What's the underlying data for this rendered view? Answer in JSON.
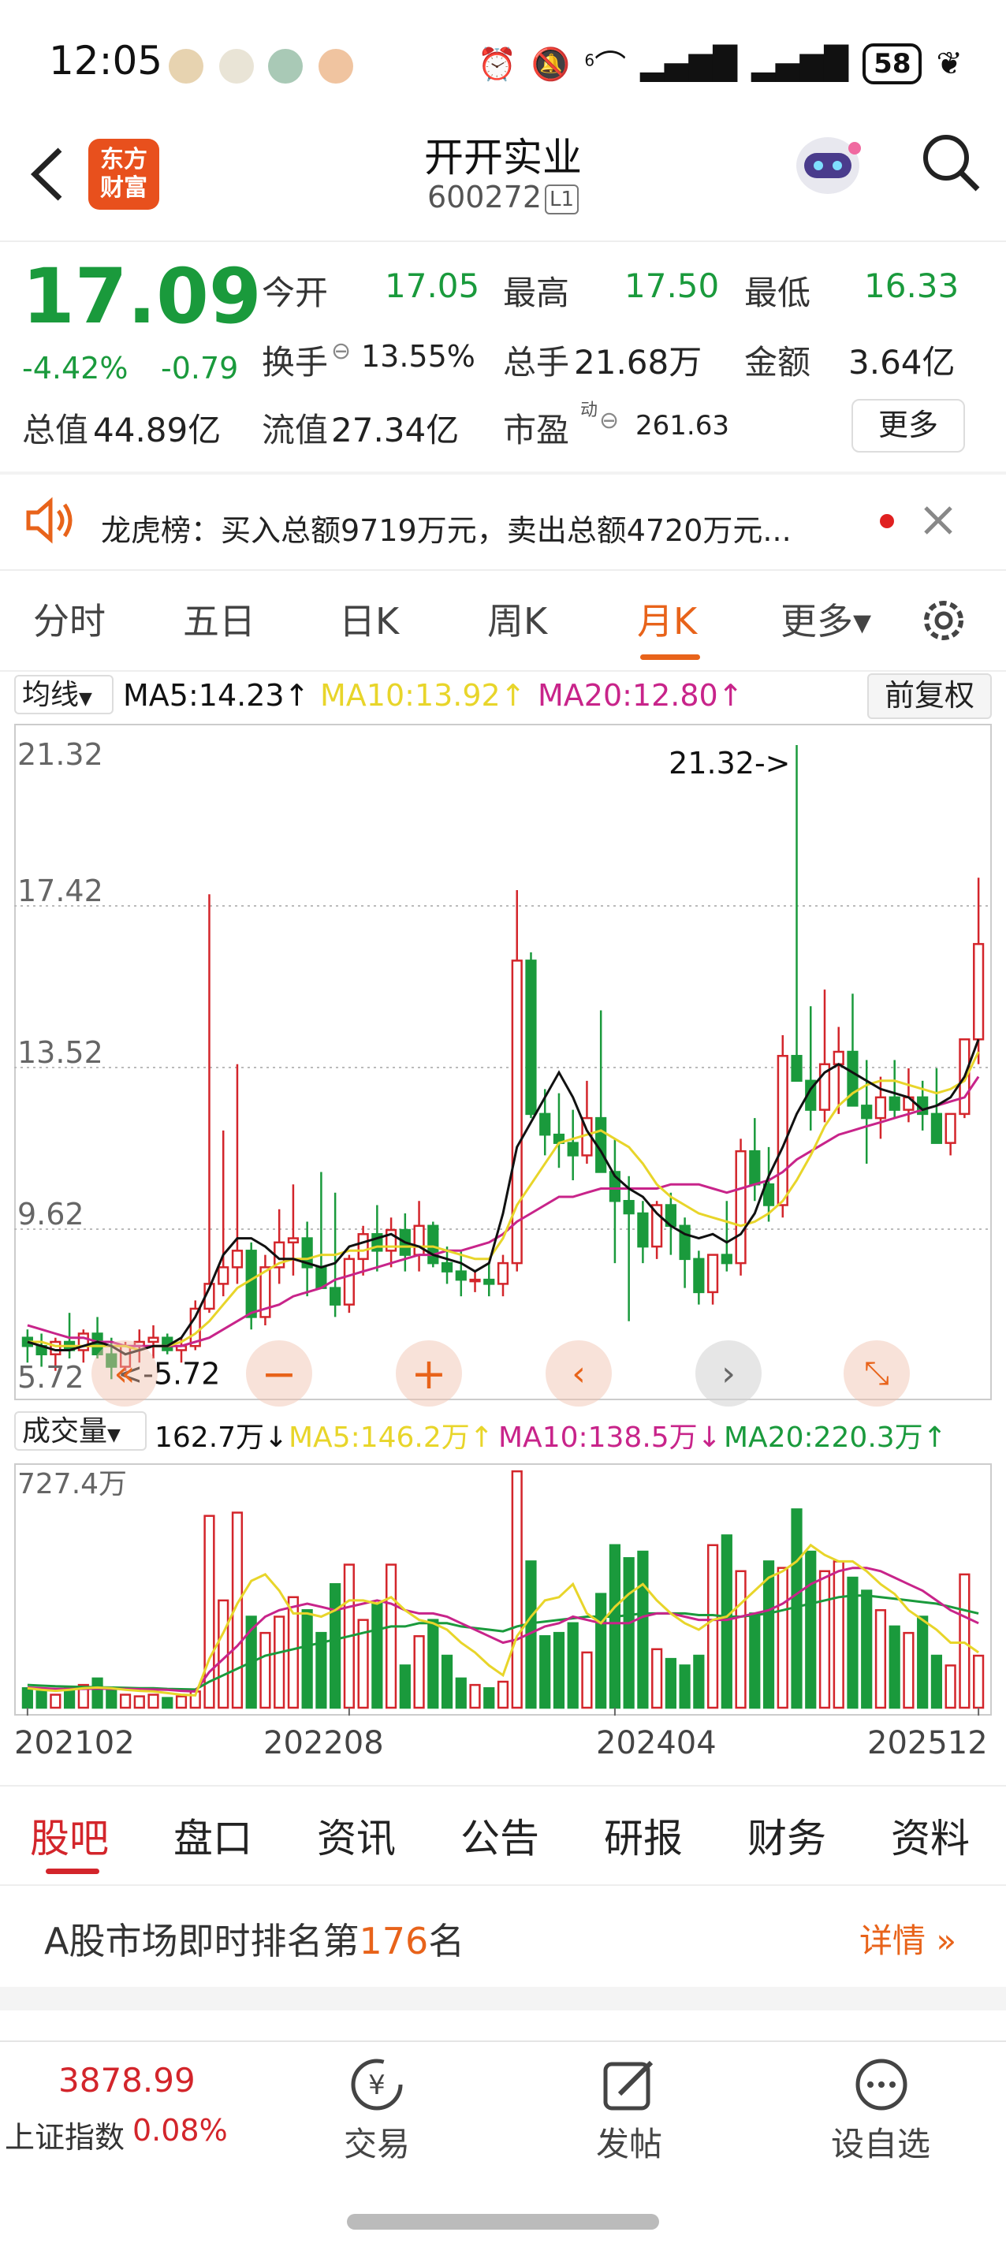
{
  "status_bar": {
    "time": "12:05",
    "signal_tag": "6",
    "battery": "58",
    "icons": [
      "alarm-icon",
      "mute-icon",
      "wifi-icon",
      "signal-icon",
      "signal-icon",
      "battery-icon",
      "leaf-icon"
    ]
  },
  "header": {
    "logo_line1": "东方",
    "logo_line2": "财富",
    "stock_name": "开开实业",
    "stock_code": "600272",
    "market_tag": "L1"
  },
  "quote": {
    "price": "17.09",
    "change_pct": "-4.42%",
    "change": "-0.79",
    "open_label": "今开",
    "open": "17.05",
    "high_label": "最高",
    "high": "17.50",
    "low_label": "最低",
    "low": "16.33",
    "turnover_label": "换手",
    "turnover": "13.55%",
    "volume_label": "总手",
    "volume": "21.68万",
    "amount_label": "金额",
    "amount": "3.64亿",
    "mktcap_label": "总值",
    "mktcap": "44.89亿",
    "float_label": "流值",
    "float_cap": "27.34亿",
    "pe_label": "市盈",
    "pe_sup": "动",
    "pe": "261.63",
    "more_label": "更多"
  },
  "notice": {
    "text": "龙虎榜：买入总额9719万元，卖出总额4720万元..."
  },
  "chart_tabs": [
    {
      "label": "分时"
    },
    {
      "label": "五日"
    },
    {
      "label": "日K"
    },
    {
      "label": "周K"
    },
    {
      "label": "月K"
    },
    {
      "label": "更多▾"
    }
  ],
  "ma_legend": {
    "selector": "均线",
    "ma5": "MA5:14.23↑",
    "ma10": "MA10:13.92↑",
    "ma20": "MA20:12.80↑",
    "adjust": "前复权"
  },
  "vol_legend": {
    "selector": "成交量",
    "vol": "162.7万↓",
    "ma5": "MA5:146.2万↑",
    "ma10": "MA10:138.5万↓",
    "ma20": "MA20:220.3万↑"
  },
  "colors": {
    "up": "#d3252b",
    "down": "#1a9a3c",
    "ma5": "#111111",
    "ma10": "#e8d52a",
    "ma20": "#c8248a",
    "accent": "#e8631a"
  },
  "chart_data": {
    "type": "candlestick",
    "price_axis_labels": [
      "21.32",
      "17.42",
      "13.52",
      "9.62",
      "5.72"
    ],
    "max_annotation": "21.32->",
    "min_annotation": "<-5.72",
    "ylim": [
      5.72,
      21.32
    ],
    "x_tick_labels": [
      "202102",
      "202208",
      "202404",
      "202512"
    ],
    "vol_axis_label": "727.4万",
    "vol_max": 727.4,
    "candles": [
      [
        7.0,
        7.2,
        6.4,
        6.8
      ],
      [
        6.8,
        7.1,
        6.3,
        6.6
      ],
      [
        6.6,
        7.0,
        6.2,
        6.9
      ],
      [
        6.9,
        7.6,
        6.5,
        6.7
      ],
      [
        6.7,
        7.2,
        6.4,
        7.1
      ],
      [
        7.1,
        7.5,
        6.5,
        6.6
      ],
      [
        6.6,
        7.0,
        6.0,
        6.3
      ],
      [
        6.3,
        6.9,
        6.2,
        6.8
      ],
      [
        6.8,
        7.2,
        6.4,
        6.9
      ],
      [
        6.9,
        7.3,
        6.5,
        7.0
      ],
      [
        7.0,
        7.1,
        6.6,
        6.7
      ],
      [
        6.7,
        7.0,
        6.4,
        6.8
      ],
      [
        6.8,
        7.9,
        6.7,
        7.7
      ],
      [
        7.7,
        17.7,
        7.6,
        8.3
      ],
      [
        8.3,
        12.0,
        8.0,
        8.7
      ],
      [
        8.7,
        13.6,
        8.3,
        9.1
      ],
      [
        9.1,
        9.3,
        7.2,
        7.5
      ],
      [
        7.5,
        9.0,
        7.3,
        8.7
      ],
      [
        8.7,
        10.1,
        8.3,
        9.3
      ],
      [
        9.3,
        10.7,
        8.5,
        9.4
      ],
      [
        9.4,
        9.8,
        8.0,
        8.7
      ],
      [
        8.7,
        11.0,
        8.3,
        8.2
      ],
      [
        8.2,
        10.5,
        7.5,
        7.8
      ],
      [
        7.8,
        9.0,
        7.6,
        8.9
      ],
      [
        8.9,
        9.7,
        8.5,
        9.5
      ],
      [
        9.5,
        10.2,
        8.6,
        9.1
      ],
      [
        9.1,
        9.9,
        8.7,
        9.6
      ],
      [
        9.6,
        10.0,
        8.6,
        9.0
      ],
      [
        9.0,
        10.3,
        8.6,
        9.7
      ],
      [
        9.7,
        9.8,
        8.7,
        8.8
      ],
      [
        8.8,
        9.2,
        8.3,
        8.6
      ],
      [
        8.6,
        9.1,
        8.0,
        8.4
      ],
      [
        8.4,
        8.6,
        8.1,
        8.4
      ],
      [
        8.4,
        8.8,
        8.0,
        8.3
      ],
      [
        8.3,
        9.0,
        8.0,
        8.8
      ],
      [
        8.8,
        17.8,
        8.6,
        16.1
      ],
      [
        16.1,
        16.3,
        12.3,
        12.4
      ],
      [
        12.4,
        13.0,
        11.4,
        11.9
      ],
      [
        11.9,
        12.9,
        11.1,
        11.7
      ],
      [
        11.7,
        12.5,
        10.8,
        11.4
      ],
      [
        11.4,
        13.2,
        11.2,
        12.3
      ],
      [
        12.3,
        14.9,
        12.0,
        11.0
      ],
      [
        11.0,
        11.8,
        8.8,
        10.3
      ],
      [
        10.3,
        10.9,
        7.4,
        10.0
      ],
      [
        10.0,
        10.3,
        8.8,
        9.2
      ],
      [
        9.2,
        10.3,
        8.9,
        10.2
      ],
      [
        10.2,
        10.5,
        9.0,
        9.7
      ],
      [
        9.7,
        9.9,
        8.2,
        8.9
      ],
      [
        8.9,
        9.1,
        7.8,
        8.1
      ],
      [
        8.1,
        8.8,
        7.8,
        9.0
      ],
      [
        9.0,
        10.3,
        8.6,
        8.8
      ],
      [
        8.8,
        11.8,
        8.5,
        11.5
      ],
      [
        11.5,
        12.3,
        10.3,
        10.7
      ],
      [
        10.7,
        11.6,
        9.8,
        10.2
      ],
      [
        10.2,
        14.3,
        9.9,
        13.8
      ],
      [
        13.8,
        21.3,
        13.5,
        13.2
      ],
      [
        13.2,
        15.0,
        12.0,
        12.5
      ],
      [
        12.5,
        15.4,
        12.2,
        13.6
      ],
      [
        13.6,
        14.5,
        12.4,
        13.9
      ],
      [
        13.9,
        15.3,
        12.6,
        12.6
      ],
      [
        12.6,
        13.7,
        11.2,
        12.3
      ],
      [
        12.3,
        13.3,
        11.8,
        12.8
      ],
      [
        12.8,
        13.7,
        12.3,
        12.5
      ],
      [
        12.5,
        13.5,
        12.2,
        12.8
      ],
      [
        12.8,
        13.2,
        12.0,
        12.4
      ],
      [
        12.4,
        13.5,
        12.2,
        11.7
      ],
      [
        11.7,
        12.3,
        11.4,
        12.4
      ],
      [
        12.4,
        14.1,
        12.3,
        14.2
      ],
      [
        14.2,
        18.1,
        13.6,
        16.5
      ]
    ],
    "ma5": [
      6.9,
      6.8,
      6.7,
      6.7,
      6.8,
      6.9,
      6.8,
      6.6,
      6.7,
      6.8,
      6.8,
      7.0,
      7.5,
      8.2,
      9.0,
      9.4,
      9.4,
      9.2,
      8.9,
      8.9,
      8.8,
      8.7,
      8.8,
      9.2,
      9.3,
      9.4,
      9.5,
      9.3,
      9.2,
      9.0,
      8.9,
      8.8,
      8.6,
      8.8,
      10.0,
      11.6,
      12.2,
      12.8,
      13.4,
      12.8,
      12.0,
      11.5,
      10.9,
      10.6,
      10.4,
      10.0,
      9.7,
      9.5,
      9.4,
      9.5,
      9.3,
      9.5,
      10.0,
      10.9,
      11.6,
      12.4,
      13.0,
      13.4,
      13.6,
      13.4,
      13.2,
      13.0,
      12.9,
      12.8,
      12.5,
      12.6,
      12.8,
      13.3,
      14.2
    ],
    "ma10": [
      6.9,
      6.9,
      6.8,
      6.8,
      6.8,
      6.8,
      6.8,
      6.8,
      6.7,
      6.8,
      6.8,
      6.9,
      7.1,
      7.4,
      7.8,
      8.2,
      8.4,
      8.6,
      8.8,
      8.9,
      8.9,
      9.0,
      9.0,
      9.1,
      9.1,
      9.2,
      9.2,
      9.2,
      9.2,
      9.2,
      9.1,
      9.0,
      8.9,
      8.9,
      9.4,
      10.2,
      10.7,
      11.2,
      11.7,
      11.8,
      11.9,
      12.0,
      11.8,
      11.6,
      11.2,
      10.7,
      10.4,
      10.2,
      10.0,
      9.9,
      9.8,
      9.7,
      9.8,
      10.0,
      10.3,
      10.8,
      11.4,
      12.1,
      12.6,
      12.9,
      13.1,
      13.2,
      13.2,
      13.1,
      13.0,
      12.9,
      13.0,
      13.2,
      13.9
    ],
    "ma20": [
      7.3,
      7.2,
      7.1,
      7.0,
      7.0,
      6.9,
      6.9,
      6.8,
      6.8,
      6.8,
      6.8,
      6.8,
      6.9,
      7.0,
      7.2,
      7.4,
      7.6,
      7.7,
      7.8,
      8.0,
      8.1,
      8.2,
      8.4,
      8.5,
      8.6,
      8.7,
      8.8,
      8.9,
      9.0,
      9.0,
      9.1,
      9.1,
      9.2,
      9.3,
      9.5,
      9.8,
      10.0,
      10.2,
      10.4,
      10.4,
      10.5,
      10.6,
      10.6,
      10.6,
      10.6,
      10.6,
      10.7,
      10.7,
      10.7,
      10.6,
      10.5,
      10.6,
      10.7,
      10.8,
      11.0,
      11.3,
      11.5,
      11.7,
      11.9,
      12.0,
      12.1,
      12.2,
      12.3,
      12.4,
      12.5,
      12.6,
      12.7,
      12.8,
      13.3
    ],
    "volumes": [
      60,
      50,
      40,
      60,
      70,
      90,
      55,
      40,
      35,
      40,
      30,
      35,
      50,
      590,
      330,
      600,
      280,
      230,
      280,
      340,
      300,
      230,
      380,
      440,
      270,
      320,
      440,
      130,
      220,
      270,
      160,
      90,
      70,
      60,
      80,
      727,
      450,
      220,
      230,
      260,
      170,
      350,
      500,
      460,
      480,
      180,
      150,
      130,
      160,
      500,
      530,
      420,
      290,
      450,
      430,
      610,
      480,
      420,
      450,
      400,
      360,
      300,
      250,
      230,
      280,
      160,
      130,
      410,
      160
    ],
    "vol_ma5": [
      60,
      55,
      52,
      55,
      60,
      62,
      60,
      55,
      52,
      50,
      45,
      40,
      38,
      150,
      230,
      320,
      390,
      410,
      360,
      290,
      290,
      280,
      300,
      330,
      330,
      320,
      340,
      300,
      270,
      260,
      240,
      200,
      170,
      130,
      100,
      220,
      280,
      330,
      340,
      380,
      290,
      260,
      310,
      350,
      380,
      330,
      290,
      260,
      240,
      270,
      280,
      320,
      360,
      400,
      420,
      450,
      500,
      470,
      450,
      450,
      420,
      380,
      350,
      300,
      270,
      240,
      200,
      200,
      170
    ],
    "vol_ma10": [
      62,
      60,
      58,
      58,
      58,
      59,
      58,
      58,
      57,
      56,
      55,
      52,
      50,
      110,
      150,
      190,
      240,
      280,
      300,
      310,
      320,
      310,
      300,
      310,
      320,
      330,
      320,
      300,
      290,
      290,
      280,
      260,
      240,
      220,
      200,
      210,
      230,
      250,
      260,
      280,
      270,
      260,
      260,
      260,
      280,
      290,
      290,
      280,
      270,
      270,
      270,
      280,
      290,
      300,
      320,
      350,
      380,
      400,
      420,
      430,
      430,
      420,
      400,
      380,
      360,
      330,
      300,
      280,
      260
    ],
    "vol_ma20": [
      70,
      68,
      66,
      65,
      64,
      63,
      62,
      61,
      60,
      60,
      58,
      57,
      56,
      80,
      100,
      120,
      140,
      160,
      170,
      180,
      190,
      200,
      210,
      220,
      230,
      240,
      250,
      250,
      260,
      260,
      260,
      250,
      245,
      240,
      235,
      250,
      260,
      265,
      270,
      275,
      280,
      280,
      280,
      285,
      290,
      290,
      290,
      290,
      285,
      285,
      280,
      280,
      285,
      290,
      300,
      310,
      320,
      330,
      340,
      345,
      345,
      340,
      335,
      330,
      325,
      320,
      310,
      300,
      290
    ]
  },
  "bottom_tabs": [
    {
      "label": "股吧"
    },
    {
      "label": "盘口"
    },
    {
      "label": "资讯"
    },
    {
      "label": "公告"
    },
    {
      "label": "研报"
    },
    {
      "label": "财务"
    },
    {
      "label": "资料"
    }
  ],
  "rank": {
    "prefix": "A股市场即时排名第",
    "number": "176",
    "suffix": "名",
    "detail": "详情"
  },
  "nav": {
    "index_value": "3878.99",
    "index_name": "上证指数",
    "index_change": "0.08%",
    "trade": "交易",
    "post": "发帖",
    "watch": "设自选"
  }
}
